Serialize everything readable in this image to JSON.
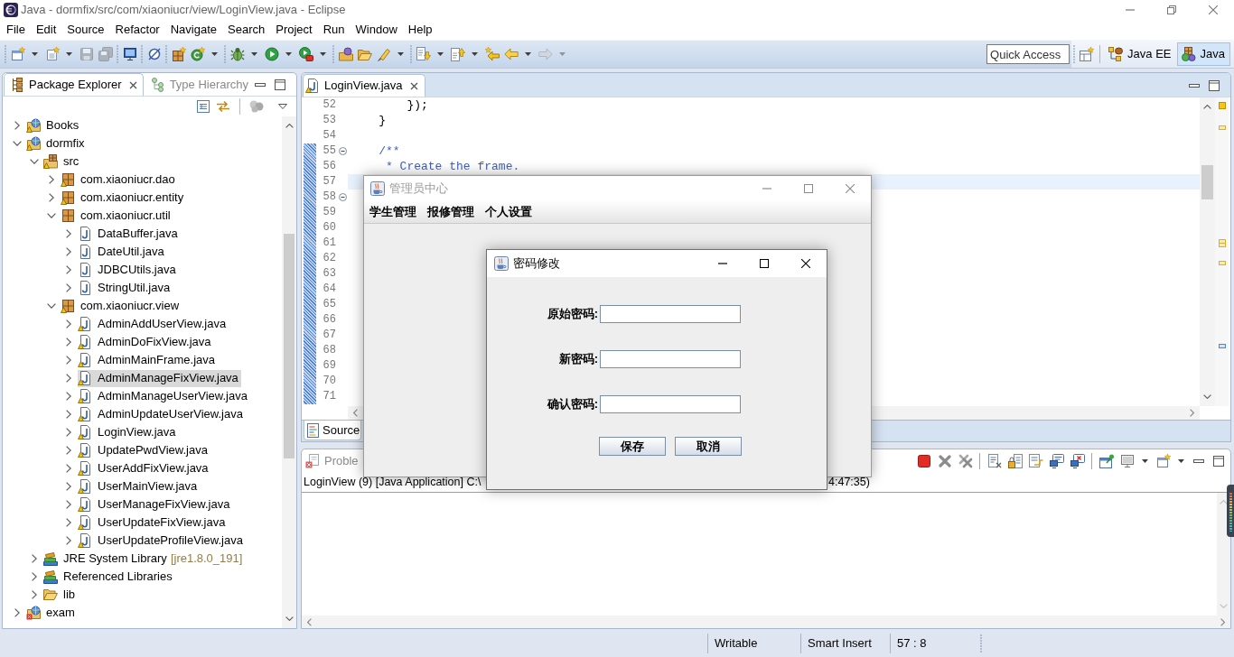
{
  "window": {
    "title": "Java - dormfix/src/com/xiaoniucr/view/LoginView.java - Eclipse",
    "active": false
  },
  "menu": [
    "File",
    "Edit",
    "Source",
    "Refactor",
    "Navigate",
    "Search",
    "Project",
    "Run",
    "Window",
    "Help"
  ],
  "toolbar": [
    [
      {
        "kind": "new-window",
        "dropdown": true,
        "disabled": false
      },
      {
        "kind": "new-item",
        "dropdown": true,
        "disabled": false
      },
      {
        "kind": "save",
        "disabled": true
      },
      {
        "kind": "save-all",
        "disabled": true
      }
    ],
    [
      {
        "kind": "monitor",
        "disabled": false
      }
    ],
    [
      {
        "kind": "skip-breakpoints",
        "disabled": false
      }
    ],
    [
      {
        "kind": "new-package",
        "disabled": false
      },
      {
        "kind": "new-class",
        "dropdown": true,
        "disabled": false
      }
    ],
    [
      {
        "kind": "debug",
        "dropdown": true,
        "disabled": false
      },
      {
        "kind": "run",
        "dropdown": true,
        "disabled": false
      },
      {
        "kind": "run-external",
        "dropdown": true,
        "disabled": false
      }
    ],
    [
      {
        "kind": "open-type",
        "disabled": false
      },
      {
        "kind": "open-folder",
        "disabled": false
      },
      {
        "kind": "search",
        "dropdown": true,
        "disabled": false
      }
    ],
    [
      {
        "kind": "next-annotation",
        "dropdown": true,
        "disabled": false
      },
      {
        "kind": "previous-annotation",
        "dropdown": true,
        "disabled": false
      },
      {
        "kind": "last-edit",
        "disabled": false
      },
      {
        "kind": "back",
        "dropdown": true,
        "disabled": false
      },
      {
        "kind": "forward",
        "dropdown": true,
        "disabled": true
      }
    ]
  ],
  "quick_access": {
    "placeholder": "Quick Access"
  },
  "perspectives": [
    {
      "label": "Java EE",
      "kind": "java-ee",
      "selected": false
    },
    {
      "label": "Java",
      "kind": "java",
      "selected": true
    }
  ],
  "package_explorer": {
    "tabs": [
      {
        "label": "Package Explorer",
        "kind": "packages",
        "selected": true
      },
      {
        "label": "Type Hierarchy",
        "kind": "hierarchy",
        "selected": false
      }
    ],
    "tree": [
      {
        "label": "Books",
        "kind": "project",
        "warning": true,
        "expanded": false,
        "selected": false
      },
      {
        "label": "dormfix",
        "kind": "project",
        "warning": true,
        "expanded": true,
        "selected": false,
        "children": [
          {
            "label": "src",
            "kind": "source-folder",
            "warning": true,
            "expanded": true,
            "selected": false,
            "children": [
              {
                "label": "com.xiaoniucr.dao",
                "kind": "package",
                "warning": true,
                "expanded": false,
                "selected": false
              },
              {
                "label": "com.xiaoniucr.entity",
                "kind": "package",
                "warning": true,
                "expanded": false,
                "selected": false
              },
              {
                "label": "com.xiaoniucr.util",
                "kind": "package",
                "warning": false,
                "expanded": true,
                "selected": false,
                "children": [
                  {
                    "label": "DataBuffer.java",
                    "kind": "java",
                    "warning": false,
                    "expanded": false,
                    "selected": false
                  },
                  {
                    "label": "DateUtil.java",
                    "kind": "java",
                    "warning": false,
                    "expanded": false,
                    "selected": false
                  },
                  {
                    "label": "JDBCUtils.java",
                    "kind": "java",
                    "warning": false,
                    "expanded": false,
                    "selected": false
                  },
                  {
                    "label": "StringUtil.java",
                    "kind": "java",
                    "warning": false,
                    "expanded": false,
                    "selected": false
                  }
                ]
              },
              {
                "label": "com.xiaoniucr.view",
                "kind": "package",
                "warning": true,
                "expanded": true,
                "selected": false,
                "children": [
                  {
                    "label": "AdminAddUserView.java",
                    "kind": "java",
                    "warning": true,
                    "expanded": false,
                    "selected": false
                  },
                  {
                    "label": "AdminDoFixView.java",
                    "kind": "java",
                    "warning": true,
                    "expanded": false,
                    "selected": false
                  },
                  {
                    "label": "AdminMainFrame.java",
                    "kind": "java",
                    "warning": true,
                    "expanded": false,
                    "selected": false
                  },
                  {
                    "label": "AdminManageFixView.java",
                    "kind": "java",
                    "warning": true,
                    "expanded": false,
                    "selected": true
                  },
                  {
                    "label": "AdminManageUserView.java",
                    "kind": "java",
                    "warning": true,
                    "expanded": false,
                    "selected": false
                  },
                  {
                    "label": "AdminUpdateUserView.java",
                    "kind": "java",
                    "warning": true,
                    "expanded": false,
                    "selected": false
                  },
                  {
                    "label": "LoginView.java",
                    "kind": "java",
                    "warning": true,
                    "expanded": false,
                    "selected": false
                  },
                  {
                    "label": "UpdatePwdView.java",
                    "kind": "java",
                    "warning": true,
                    "expanded": false,
                    "selected": false
                  },
                  {
                    "label": "UserAddFixView.java",
                    "kind": "java",
                    "warning": true,
                    "expanded": false,
                    "selected": false
                  },
                  {
                    "label": "UserMainView.java",
                    "kind": "java",
                    "warning": true,
                    "expanded": false,
                    "selected": false
                  },
                  {
                    "label": "UserManageFixView.java",
                    "kind": "java",
                    "warning": true,
                    "expanded": false,
                    "selected": false
                  },
                  {
                    "label": "UserUpdateFixView.java",
                    "kind": "java",
                    "warning": true,
                    "expanded": false,
                    "selected": false
                  },
                  {
                    "label": "UserUpdateProfileView.java",
                    "kind": "java",
                    "warning": true,
                    "expanded": false,
                    "selected": false
                  }
                ]
              }
            ]
          },
          {
            "label": "JRE System Library",
            "decoration": "[jre1.8.0_191]",
            "kind": "library",
            "warning": false,
            "expanded": false,
            "selected": false
          },
          {
            "label": "Referenced Libraries",
            "kind": "library",
            "warning": false,
            "expanded": false,
            "selected": false
          },
          {
            "label": "lib",
            "kind": "folder",
            "warning": false,
            "expanded": false,
            "selected": false
          }
        ]
      },
      {
        "label": "exam",
        "kind": "project",
        "error": true,
        "expanded": false,
        "selected": false
      }
    ]
  },
  "editor": {
    "tabs": [
      {
        "label": "LoginView.java",
        "kind": "java",
        "warning": true,
        "selected": true
      }
    ],
    "lines": [
      {
        "number": "52",
        "kind": "code",
        "code": "        });",
        "current": false,
        "foldable": false,
        "changed": false
      },
      {
        "number": "53",
        "kind": "code",
        "code": "    }",
        "current": false,
        "foldable": false,
        "changed": false
      },
      {
        "number": "54",
        "current": false,
        "foldable": false,
        "changed": false
      },
      {
        "number": "55",
        "kind": "javadoc",
        "code": "    /**",
        "current": false,
        "foldable": true,
        "changed": true
      },
      {
        "number": "56",
        "kind": "javadoc",
        "code": "     * Create the frame.",
        "current": false,
        "foldable": false,
        "changed": true
      },
      {
        "number": "57",
        "current": true,
        "foldable": false,
        "changed": true
      },
      {
        "number": "58",
        "current": false,
        "foldable": true,
        "changed": true
      },
      {
        "number": "59",
        "current": false,
        "foldable": false,
        "changed": true
      },
      {
        "number": "60",
        "current": false,
        "foldable": false,
        "changed": true
      },
      {
        "number": "61",
        "current": false,
        "foldable": false,
        "changed": true
      },
      {
        "number": "62",
        "current": false,
        "foldable": false,
        "changed": true
      },
      {
        "number": "63",
        "current": false,
        "foldable": false,
        "changed": true
      },
      {
        "number": "64",
        "current": false,
        "foldable": false,
        "changed": true
      },
      {
        "number": "65",
        "current": false,
        "foldable": false,
        "changed": true
      },
      {
        "number": "66",
        "current": false,
        "foldable": false,
        "changed": true
      },
      {
        "number": "67",
        "current": false,
        "foldable": false,
        "changed": true
      },
      {
        "number": "68",
        "current": false,
        "foldable": false,
        "changed": true
      },
      {
        "number": "69",
        "current": false,
        "foldable": false,
        "changed": true
      },
      {
        "number": "70",
        "current": false,
        "foldable": false,
        "changed": true
      },
      {
        "number": "71",
        "current": false,
        "foldable": false,
        "changed": true
      }
    ],
    "bottom_tabs": [
      {
        "label": "Source",
        "kind": "source",
        "selected": true
      }
    ]
  },
  "console": {
    "tabs": [
      {
        "label": "Proble",
        "kind": "problems",
        "selected": false
      }
    ],
    "label_parts": [
      "LoginView (9) [Java Application] C:\\",
      "4:47:35)"
    ]
  },
  "windows": [
    {
      "kind": "frame",
      "title": "管理员中心",
      "active": false,
      "menu": [
        "学生管理",
        "报修管理",
        "个人设置"
      ]
    },
    {
      "kind": "dialog",
      "title": "密码修改",
      "active": true,
      "fields": [
        {
          "label": "原始密码:"
        },
        {
          "label": "新密码:"
        },
        {
          "label": "确认密码:"
        }
      ],
      "buttons": [
        "保存",
        "取消"
      ]
    }
  ],
  "status_bar": [
    "Writable",
    "Smart Insert",
    "57 : 8"
  ]
}
